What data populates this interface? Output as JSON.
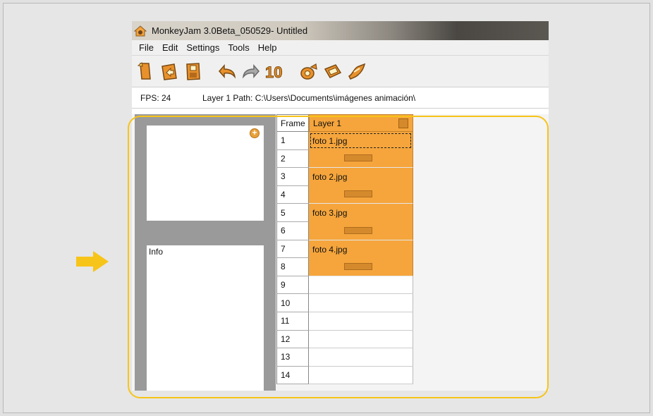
{
  "window": {
    "title": "MonkeyJam 3.0Beta_050529- Untitled"
  },
  "menu": [
    "File",
    "Edit",
    "Settings",
    "Tools",
    "Help"
  ],
  "toolbar": {
    "buttons": [
      {
        "icon": "new-file-icon"
      },
      {
        "icon": "open-file-icon"
      },
      {
        "icon": "save-file-icon"
      },
      {
        "icon": "undo-icon"
      },
      {
        "icon": "redo-icon"
      },
      {
        "icon": "ten-frames-icon",
        "text": "10"
      },
      {
        "icon": "camera-capture-icon"
      },
      {
        "icon": "import-image-icon"
      },
      {
        "icon": "playback-icon"
      }
    ]
  },
  "status": {
    "fps": "FPS: 24",
    "path": "Layer 1 Path: C:\\Users\\Documents\\imágenes animación\\"
  },
  "left_panel": {
    "info_label": "Info"
  },
  "grid": {
    "frame_header": "Frame",
    "layer_header": "Layer 1",
    "frames": [
      "1",
      "2",
      "3",
      "4",
      "5",
      "6",
      "7",
      "8",
      "9",
      "10",
      "11",
      "12",
      "13",
      "14"
    ],
    "cells": [
      {
        "name": "foto 1.jpg",
        "frames": 2,
        "selected": true
      },
      {
        "name": "foto 2.jpg",
        "frames": 2,
        "selected": false
      },
      {
        "name": "foto 3.jpg",
        "frames": 2,
        "selected": false
      },
      {
        "name": "foto 4.jpg",
        "frames": 2,
        "selected": false
      }
    ]
  },
  "colors": {
    "layer_orange": "#f5a53c",
    "highlight_yellow": "#f7c419"
  }
}
